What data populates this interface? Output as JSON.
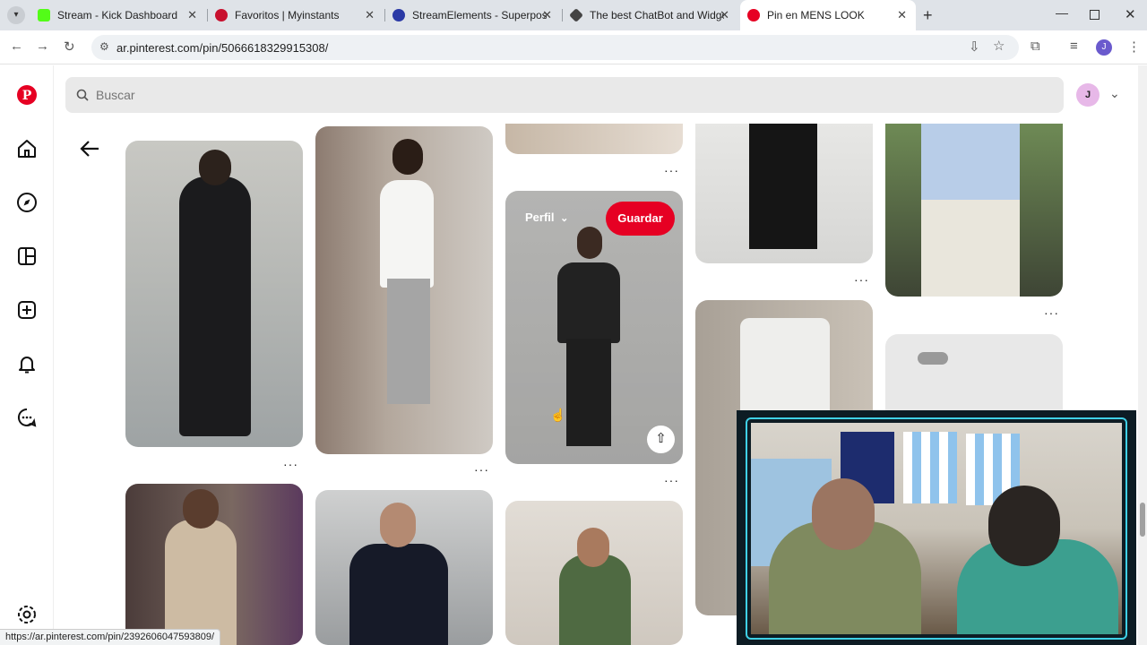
{
  "browser": {
    "tabs": [
      {
        "title": "Stream - Kick Dashboard",
        "color": "#53fc18"
      },
      {
        "title": "Favoritos | Myinstants",
        "color": "#c8102e"
      },
      {
        "title": "StreamElements - Superposicio",
        "color": "#2b3aa6"
      },
      {
        "title": "The best ChatBot and Widgets",
        "color": "#444444"
      },
      {
        "title": "Pin en MENS LOOK",
        "color": "#e60023"
      }
    ],
    "url": "ar.pinterest.com/pin/5066618329915308/",
    "profile_initial": "J",
    "status_url": "https://ar.pinterest.com/pin/2392606047593809/"
  },
  "pinterest": {
    "search_placeholder": "Buscar",
    "avatar_initial": "J",
    "hover_pin": {
      "profile_label": "Perfil",
      "save_label": "Guardar"
    },
    "more_label": "···",
    "brand_color": "#e60023"
  }
}
